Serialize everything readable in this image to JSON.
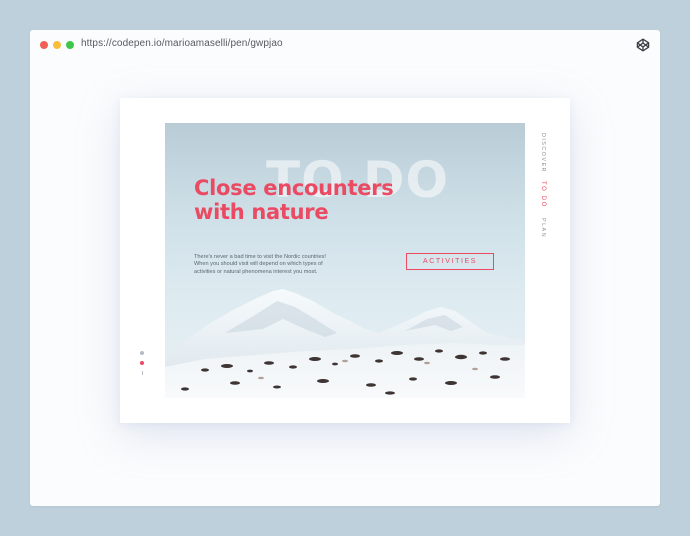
{
  "browser": {
    "url": "https://codepen.io/marioamaselli/pen/gwpjao",
    "icon": "codepen-icon"
  },
  "hero": {
    "ghost_text": "TO DO",
    "headline_lines": [
      "Close encounters",
      "with nature"
    ],
    "body_lines": [
      "There's never a bad time to visit the Nordic countries!",
      "When you should visit will depend on which types of",
      "activities or natural phenomena interest you most."
    ],
    "cta_label": "ACTIVITIES"
  },
  "side_nav": {
    "items": [
      "DISCOVER",
      "TO DO",
      "PLAN"
    ],
    "active": "TO DO"
  },
  "pager": {
    "active_index": 1
  },
  "colors": {
    "accent": "#ea4a62",
    "page_background": "#bfd0dd",
    "card": "#ffffff"
  }
}
